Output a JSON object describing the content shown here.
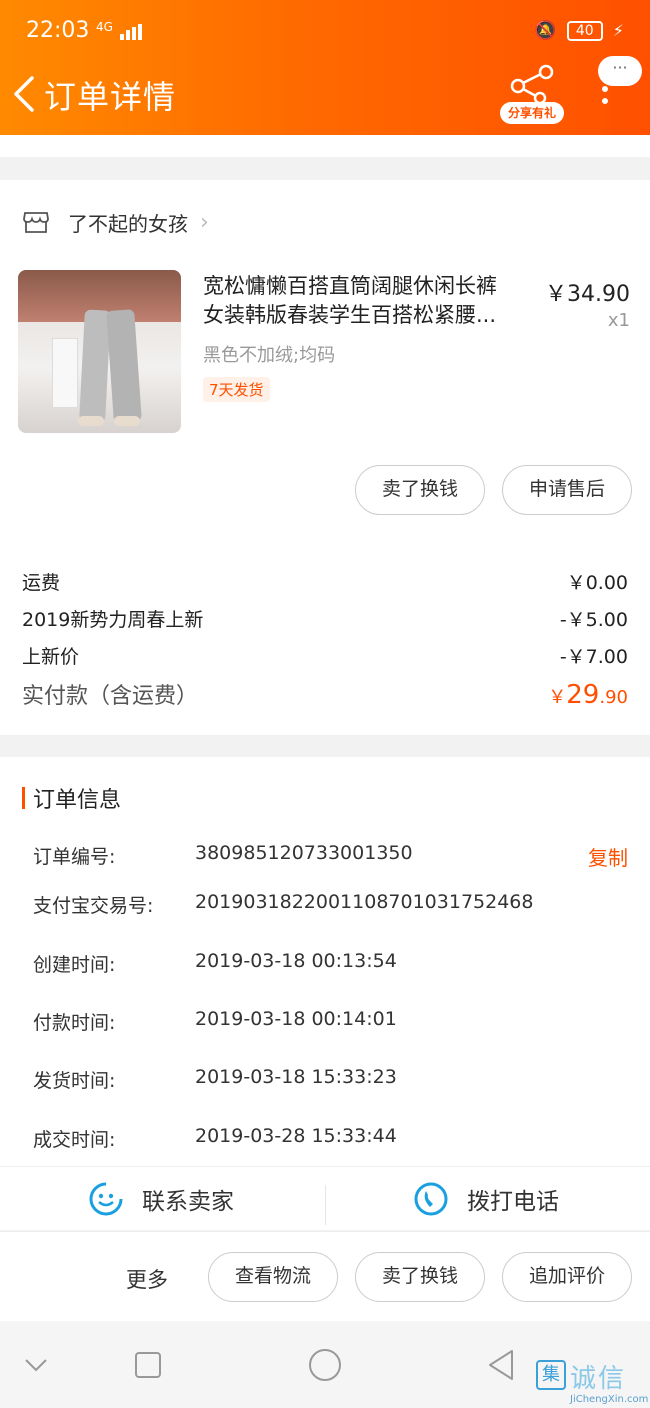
{
  "status_bar": {
    "time": "22:03",
    "network": "4G",
    "battery": "40"
  },
  "header": {
    "title": "订单详情",
    "share_label": "分享有礼",
    "bubble_label": "···"
  },
  "store": {
    "name": "了不起的女孩"
  },
  "product": {
    "title_line1": "宽松慵懒百搭直筒阔腿休闲长裤",
    "title_line2": "女装韩版春装学生百搭松紧腰...",
    "price": "￥34.90",
    "quantity": "x1",
    "sku": "黑色不加绒;均码",
    "tag": "7天发货",
    "buttons": [
      "卖了换钱",
      "申请售后"
    ]
  },
  "fees": [
    {
      "label": "运费",
      "value": "￥0.00"
    },
    {
      "label": "2019新势力周春上新",
      "value": "-￥5.00"
    },
    {
      "label": "上新价",
      "value": "-￥7.00"
    }
  ],
  "total": {
    "label": "实付款（含运费）",
    "currency": "￥",
    "integer": "29",
    "decimal": ".90"
  },
  "order_info": {
    "heading": "订单信息",
    "copy_label": "复制",
    "rows": [
      {
        "key": "订单编号:",
        "value": "380985120733001350"
      },
      {
        "key": "支付宝交易号:",
        "value": "2019031822001108701031752468"
      },
      {
        "key": "创建时间:",
        "value": "2019-03-18 00:13:54"
      },
      {
        "key": "付款时间:",
        "value": "2019-03-18 00:14:01"
      },
      {
        "key": "发货时间:",
        "value": "2019-03-18 15:33:23"
      },
      {
        "key": "成交时间:",
        "value": "2019-03-28 15:33:44"
      }
    ]
  },
  "contact": {
    "seller": "联系卖家",
    "phone": "拨打电话"
  },
  "bottom_actions": {
    "more": "更多",
    "buttons": [
      "查看物流",
      "卖了换钱",
      "追加评价"
    ]
  },
  "watermark": {
    "text": "JiChengXin.com"
  },
  "colors": {
    "accent": "#ff5000",
    "header_start": "#ff8a00",
    "icon_blue": "#1aa0e0"
  }
}
